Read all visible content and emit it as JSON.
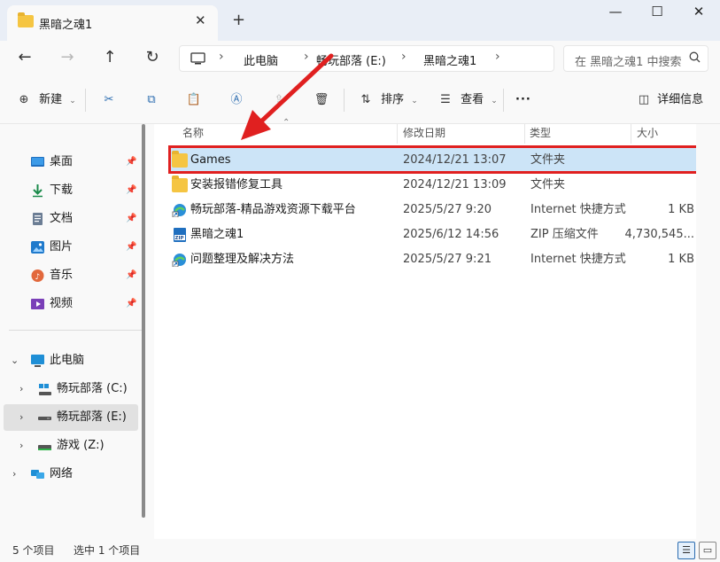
{
  "window": {
    "tab_title": "黑暗之魂1",
    "close_tab": "✕",
    "new_tab": "+",
    "minimize": "—",
    "maximize": "☐",
    "close": "✕"
  },
  "nav": {
    "back": "←",
    "forward": "→",
    "up": "↑",
    "refresh": "↻"
  },
  "address": {
    "crumbs": [
      "此电脑",
      "畅玩部落 (E:)",
      "黑暗之魂1"
    ],
    "separator": "›"
  },
  "search": {
    "placeholder": "在 黑暗之魂1 中搜索"
  },
  "toolbar": {
    "new_label": "新建",
    "sort_label": "排序",
    "view_label": "查看",
    "more_label": "···",
    "details_label": "详细信息"
  },
  "sidebar": {
    "quick": [
      {
        "label": "桌面",
        "icon": "desktop-icon"
      },
      {
        "label": "下载",
        "icon": "download-icon"
      },
      {
        "label": "文档",
        "icon": "document-icon"
      },
      {
        "label": "图片",
        "icon": "picture-icon"
      },
      {
        "label": "音乐",
        "icon": "music-icon"
      },
      {
        "label": "视频",
        "icon": "video-icon"
      }
    ],
    "pc_label": "此电脑",
    "drives": [
      {
        "label": "畅玩部落 (C:)"
      },
      {
        "label": "畅玩部落 (E:)"
      },
      {
        "label": "游戏 (Z:)"
      }
    ],
    "network_label": "网络"
  },
  "columns": {
    "name": "名称",
    "date": "修改日期",
    "type": "类型",
    "size": "大小"
  },
  "files": [
    {
      "name": "Games",
      "date": "2024/12/21 13:07",
      "type": "文件夹",
      "size": "",
      "icon": "folder-icon"
    },
    {
      "name": "安装报错修复工具",
      "date": "2024/12/21 13:09",
      "type": "文件夹",
      "size": "",
      "icon": "folder-icon"
    },
    {
      "name": "畅玩部落-精品游戏资源下载平台",
      "date": "2025/5/27 9:20",
      "type": "Internet 快捷方式",
      "size": "1 KB",
      "icon": "internet-shortcut-icon"
    },
    {
      "name": "黑暗之魂1",
      "date": "2025/6/12 14:56",
      "type": "ZIP 压缩文件",
      "size": "4,730,545...",
      "icon": "zip-icon"
    },
    {
      "name": "问题整理及解决方法",
      "date": "2025/5/27 9:21",
      "type": "Internet 快捷方式",
      "size": "1 KB",
      "icon": "internet-shortcut-icon"
    }
  ],
  "status": {
    "count": "5 个项目",
    "selected": "选中 1 个项目"
  },
  "colors": {
    "selection": "#cce4f7",
    "highlight_border": "#e02020",
    "arrow": "#e02020",
    "folder": "#f5c542"
  }
}
